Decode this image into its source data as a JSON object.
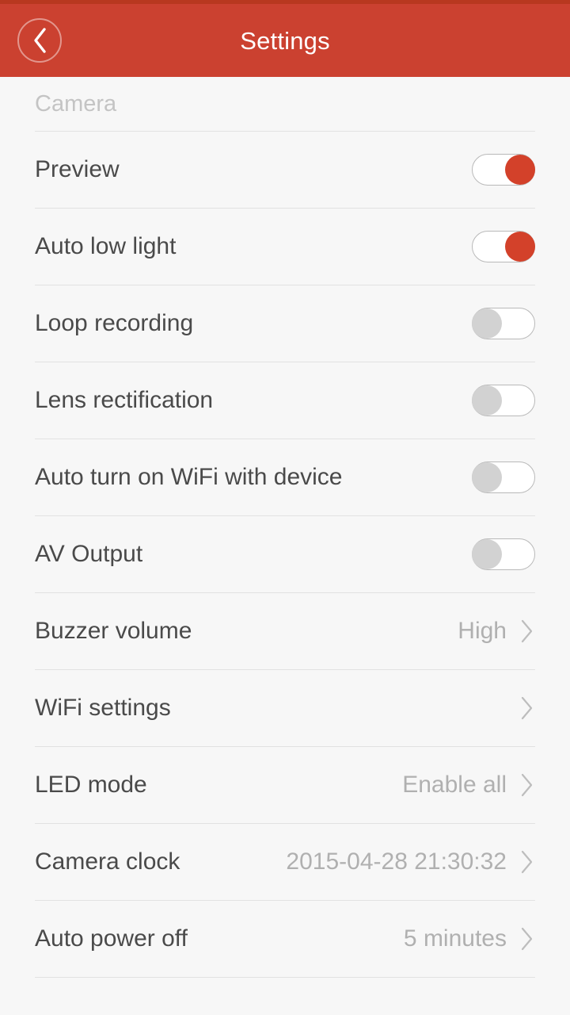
{
  "header": {
    "title": "Settings",
    "back_icon": "chevron-left-icon",
    "background_color": "#cb4130",
    "status_strip_color": "#b8381f",
    "title_color": "#ffffff"
  },
  "colors": {
    "page_background": "#f7f7f7",
    "accent": "#d3412a",
    "divider": "#e2e2e2",
    "label_text": "#4a4a4a",
    "value_text": "#b0b0b0",
    "section_header_text": "#c4c4c4",
    "toggle_off_knob": "#d2d2d2",
    "toggle_track_border": "#b9b9b9"
  },
  "sections": [
    {
      "title": "Camera",
      "rows": [
        {
          "label": "Preview",
          "type": "toggle",
          "state": "on",
          "value": "",
          "chevron": false
        },
        {
          "label": "Auto low light",
          "type": "toggle",
          "state": "on",
          "value": "",
          "chevron": false
        },
        {
          "label": "Loop recording",
          "type": "toggle",
          "state": "off",
          "value": "",
          "chevron": false
        },
        {
          "label": "Lens rectification",
          "type": "toggle",
          "state": "off",
          "value": "",
          "chevron": false
        },
        {
          "label": "Auto turn on WiFi with device",
          "type": "toggle",
          "state": "off",
          "value": "",
          "chevron": false
        },
        {
          "label": "AV Output",
          "type": "toggle",
          "state": "off",
          "value": "",
          "chevron": false
        },
        {
          "label": "Buzzer volume",
          "type": "value",
          "state": "",
          "value": "High",
          "chevron": true
        },
        {
          "label": "WiFi settings",
          "type": "value",
          "state": "",
          "value": "",
          "chevron": true
        },
        {
          "label": "LED mode",
          "type": "value",
          "state": "",
          "value": "Enable all",
          "chevron": true
        },
        {
          "label": "Camera clock",
          "type": "value",
          "state": "",
          "value": "2015-04-28 21:30:32",
          "chevron": true
        },
        {
          "label": "Auto power off",
          "type": "value",
          "state": "",
          "value": "5 minutes",
          "chevron": true
        }
      ]
    }
  ]
}
